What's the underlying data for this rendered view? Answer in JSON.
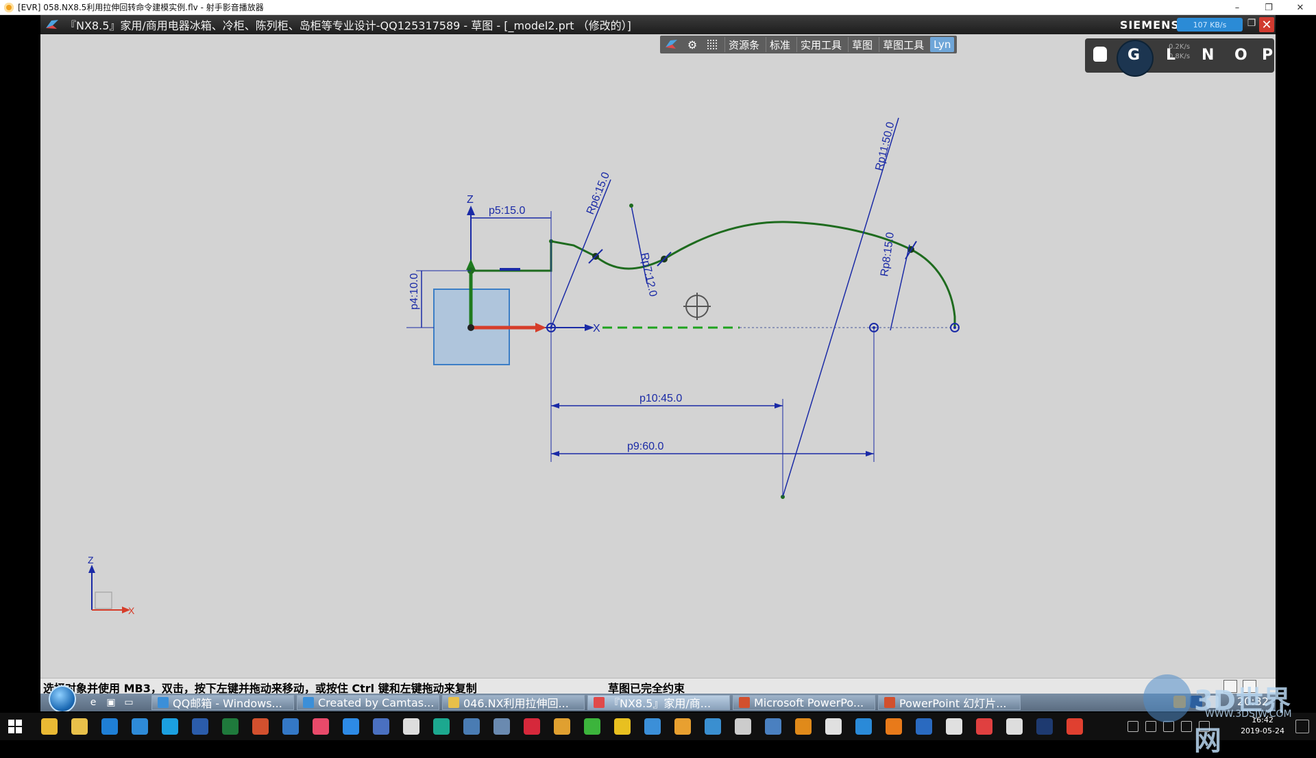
{
  "player": {
    "title": "[EVR] 058.NX8.5利用拉伸回转命令建模实例.flv - 射手影音播放器",
    "minimize": "–",
    "restore": "❐",
    "close": "✕"
  },
  "nx": {
    "window_title": "『NX8.5』家用/商用电器冰箱、冷柜、陈列柜、岛柜等专业设计-QQ125317589 - 草图 - [_model2.prt （修改的）]",
    "brand": "SIEMENS",
    "net_speed": "107 KB/s",
    "toolbar": [
      "资源条",
      "标准",
      "实用工具",
      "草图",
      "草图工具",
      "Lyn"
    ],
    "overlay_keys": [
      "G",
      "L",
      "N",
      "O",
      "P"
    ],
    "overlay_rates": [
      "0.2K/s",
      "0.8K/s"
    ],
    "status_prompt": "选择对象并使用 MB3，双击，按下左键并拖动来移动，或按住 Ctrl 键和左键拖动来复制",
    "status_state": "草图已完全约束"
  },
  "sketch": {
    "dimensions": [
      "p5:15.0",
      "p4:10.0",
      "Rp6:15.0",
      "Rp7:12.0",
      "Rp11:50.0",
      "Rp8:15.0",
      "p10:45.0",
      "p9:60.0"
    ],
    "axis_labels": {
      "z_top": "Z",
      "x_inline": "X",
      "triad_z": "Z",
      "triad_x": "X"
    },
    "colors": {
      "curve": "#1e6b1e",
      "dimension": "#1a2aa6",
      "block": "#9fbfe0",
      "background": "#d3d3d3"
    }
  },
  "inner_taskbar": {
    "tasks": [
      "QQ邮箱 - Windows...",
      "Created by Camtas...",
      "046.NX利用拉伸回...",
      "『NX8.5』家用/商...",
      "Microsoft PowerPo...",
      "PowerPoint 幻灯片..."
    ],
    "clock": "20:32"
  },
  "host_taskbar": {
    "time": "16:42",
    "date": "2019-05-24"
  },
  "watermark": {
    "text": "3D世界网",
    "url": "WWW.3DSJW.COM"
  }
}
